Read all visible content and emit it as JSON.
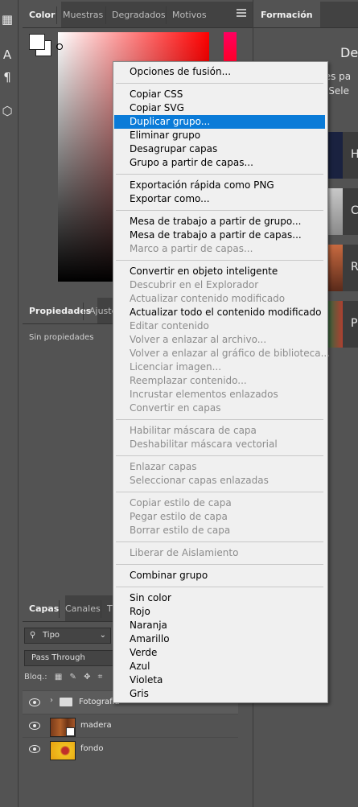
{
  "tools": [
    {
      "icon": "artboard-tool-icon",
      "glyph": "▦"
    },
    {
      "icon": "type-tool-icon",
      "glyph": "A"
    },
    {
      "icon": "paragraph-icon",
      "glyph": "¶"
    },
    {
      "icon": "3d-cube-icon",
      "glyph": "⬡"
    }
  ],
  "top_tabs": [
    "Color",
    "Muestras",
    "Degradados",
    "Motivos"
  ],
  "props_tabs": [
    "Propiedades",
    "Ajuste"
  ],
  "props_text": "Sin propiedades",
  "layers_tabs": [
    "Capas",
    "Canales",
    "T"
  ],
  "layers": {
    "filter_label": "Tipo",
    "blend_mode": "Pass Through",
    "lock_label": "Bloq.:",
    "rows": [
      {
        "name": "Fotografía",
        "type": "group"
      },
      {
        "name": "madera",
        "type": "smart"
      },
      {
        "name": "fondo",
        "type": "image"
      }
    ]
  },
  "right_panel": {
    "tab": "Formación",
    "title_partial": "Des",
    "line1": "ales pa",
    "line2": "n. Sele",
    "cards": [
      "H",
      "C",
      "R",
      "P"
    ]
  },
  "menu": {
    "items": [
      {
        "label": "Opciones de fusión...",
        "disabled": false
      },
      {
        "sep": true
      },
      {
        "label": "Copiar CSS",
        "disabled": false
      },
      {
        "label": "Copiar SVG",
        "disabled": false
      },
      {
        "label": "Duplicar grupo...",
        "disabled": false,
        "highlighted": true
      },
      {
        "label": "Eliminar grupo",
        "disabled": false
      },
      {
        "label": "Desagrupar capas",
        "disabled": false
      },
      {
        "label": "Grupo a partir de capas...",
        "disabled": false
      },
      {
        "sep": true
      },
      {
        "label": "Exportación rápida como PNG",
        "disabled": false
      },
      {
        "label": "Exportar como...",
        "disabled": false
      },
      {
        "sep": true
      },
      {
        "label": "Mesa de trabajo a partir de grupo...",
        "disabled": false
      },
      {
        "label": "Mesa de trabajo a partir de capas...",
        "disabled": false
      },
      {
        "label": "Marco a partir de capas...",
        "disabled": true
      },
      {
        "sep": true
      },
      {
        "label": "Convertir en objeto inteligente",
        "disabled": false
      },
      {
        "label": "Descubrir en el Explorador",
        "disabled": true
      },
      {
        "label": "Actualizar contenido modificado",
        "disabled": true
      },
      {
        "label": "Actualizar todo el contenido modificado",
        "disabled": false
      },
      {
        "label": "Editar contenido",
        "disabled": true
      },
      {
        "label": "Volver a enlazar al archivo...",
        "disabled": true
      },
      {
        "label": "Volver a enlazar al gráfico de biblioteca...",
        "disabled": true
      },
      {
        "label": "Licenciar imagen...",
        "disabled": true
      },
      {
        "label": "Reemplazar contenido...",
        "disabled": true
      },
      {
        "label": "Incrustar elementos enlazados",
        "disabled": true
      },
      {
        "label": "Convertir en capas",
        "disabled": true
      },
      {
        "sep": true
      },
      {
        "label": "Habilitar máscara de capa",
        "disabled": true
      },
      {
        "label": "Deshabilitar máscara vectorial",
        "disabled": true
      },
      {
        "sep": true
      },
      {
        "label": "Enlazar capas",
        "disabled": true
      },
      {
        "label": "Seleccionar capas enlazadas",
        "disabled": true
      },
      {
        "sep": true
      },
      {
        "label": "Copiar estilo de capa",
        "disabled": true
      },
      {
        "label": "Pegar estilo de capa",
        "disabled": true
      },
      {
        "label": "Borrar estilo de capa",
        "disabled": true
      },
      {
        "sep": true
      },
      {
        "label": "Liberar de Aislamiento",
        "disabled": true
      },
      {
        "sep": true
      },
      {
        "label": "Combinar grupo",
        "disabled": false
      },
      {
        "sep": true
      },
      {
        "label": "Sin color",
        "disabled": false
      },
      {
        "label": "Rojo",
        "disabled": false
      },
      {
        "label": "Naranja",
        "disabled": false
      },
      {
        "label": "Amarillo",
        "disabled": false
      },
      {
        "label": "Verde",
        "disabled": false
      },
      {
        "label": "Azul",
        "disabled": false
      },
      {
        "label": "Violeta",
        "disabled": false
      },
      {
        "label": "Gris",
        "disabled": false
      }
    ]
  }
}
